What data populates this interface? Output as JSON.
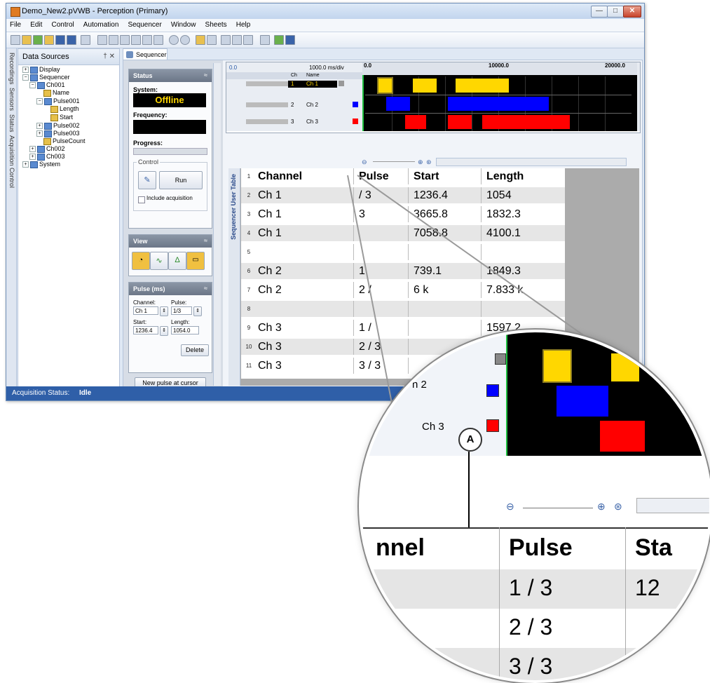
{
  "window": {
    "title": "Demo_New2.pVWB - Perception (Primary)",
    "minimize": "—",
    "maximize": "□",
    "close": "✕"
  },
  "menu": [
    "File",
    "Edit",
    "Control",
    "Automation",
    "Sequencer",
    "Window",
    "Sheets",
    "Help"
  ],
  "vertical_tabs": [
    "Recordings",
    "Sensors",
    "Status",
    "Acquisition Control"
  ],
  "data_sources": {
    "title": "Data Sources",
    "controls": "† ✕",
    "tree": [
      "Display",
      "Sequencer",
      "Ch001",
      "Name",
      "Pulse001",
      "Length",
      "Start",
      "Pulse002",
      "Pulse003",
      "PulseCount",
      "Ch002",
      "Ch003",
      "System"
    ]
  },
  "doc_tab": "Sequencer",
  "status_panel": {
    "header": "Status",
    "system_label": "System:",
    "system_value": "Offline",
    "frequency_label": "Frequency:",
    "progress_label": "Progress:",
    "control_label": "Control",
    "run_label": "Run",
    "include_label": "Include acquisition"
  },
  "view_panel": {
    "header": "View"
  },
  "pulse_panel": {
    "header": "Pulse (ms)",
    "channel_label": "Channel:",
    "channel_value": "Ch 1",
    "pulse_label": "Pulse:",
    "pulse_value": "1/3",
    "start_label": "Start:",
    "start_value": "1236.4",
    "length_label": "Length:",
    "length_value": "1054.0",
    "delete_label": "Delete",
    "new_pulse_label": "New pulse at cursor"
  },
  "grid": {
    "origin": "0.0",
    "rate": "1000.0 ms/div",
    "ch_header": "Ch",
    "name_header": "Name",
    "rows": [
      {
        "ch": "1",
        "name": "Ch 1",
        "color": "#999999"
      },
      {
        "ch": "2",
        "name": "Ch 2",
        "color": "#0000ff"
      },
      {
        "ch": "3",
        "name": "Ch 3",
        "color": "#ff0000"
      }
    ]
  },
  "timeline": {
    "ticks": [
      "0.0",
      "10000.0",
      "20000.0"
    ],
    "pulses": [
      {
        "row": 0,
        "start_frac": 0.05,
        "len_frac": 0.05,
        "color": "#ffd700",
        "selected": true
      },
      {
        "row": 0,
        "start_frac": 0.18,
        "len_frac": 0.09,
        "color": "#ffd700"
      },
      {
        "row": 0,
        "start_frac": 0.34,
        "len_frac": 0.2,
        "color": "#ffd700"
      },
      {
        "row": 1,
        "start_frac": 0.08,
        "len_frac": 0.09,
        "color": "#0000ff"
      },
      {
        "row": 1,
        "start_frac": 0.31,
        "len_frac": 0.38,
        "color": "#0000ff"
      },
      {
        "row": 2,
        "start_frac": 0.15,
        "len_frac": 0.08,
        "color": "#ff0000"
      },
      {
        "row": 2,
        "start_frac": 0.31,
        "len_frac": 0.09,
        "color": "#ff0000"
      },
      {
        "row": 2,
        "start_frac": 0.44,
        "len_frac": 0.33,
        "color": "#ff0000"
      }
    ]
  },
  "table": {
    "side_label": "Sequencer User Table",
    "headers": [
      "Channel",
      "Pulse",
      "Start",
      "Length"
    ],
    "rows": [
      {
        "n": "1",
        "header": true
      },
      {
        "n": "2",
        "channel": "Ch 1",
        "pulse": "/ 3",
        "start": "1236.4",
        "length": "1054"
      },
      {
        "n": "3",
        "channel": "Ch 1",
        "pulse": "3",
        "start": "3665.8",
        "length": "1832.3"
      },
      {
        "n": "4",
        "channel": "Ch 1",
        "pulse": "",
        "start": "7058.8",
        "length": "4100.1"
      },
      {
        "n": "5",
        "channel": "",
        "pulse": "",
        "start": "",
        "length": ""
      },
      {
        "n": "6",
        "channel": "Ch 2",
        "pulse": "1",
        "start": "739.1",
        "length": "1849.3"
      },
      {
        "n": "7",
        "channel": "Ch 2",
        "pulse": "2 /",
        "start": "6 k",
        "length": "7.833 k"
      },
      {
        "n": "8",
        "channel": "",
        "pulse": "",
        "start": "",
        "length": ""
      },
      {
        "n": "9",
        "channel": "Ch 3",
        "pulse": "1 /",
        "start": "",
        "length": "1597.2"
      },
      {
        "n": "10",
        "channel": "Ch 3",
        "pulse": "2 / 3",
        "start": "",
        "length": ""
      },
      {
        "n": "11",
        "channel": "Ch 3",
        "pulse": "3 / 3",
        "start": "",
        "length": ""
      }
    ]
  },
  "status_bar": {
    "label": "Acquisition Status:",
    "value": "Idle"
  },
  "magnifier": {
    "ch2_label": "h 2",
    "ch3_label": "Ch 3",
    "callout": "A",
    "channel_header": "nnel",
    "pulse_header": "Pulse",
    "start_header": "Sta",
    "pulses": [
      "1 / 3",
      "2 / 3",
      "3 / 3"
    ],
    "start_partial": [
      "12",
      "",
      "",
      ""
    ],
    "ch_colors": [
      "#0000ff",
      "#ff0000"
    ]
  }
}
